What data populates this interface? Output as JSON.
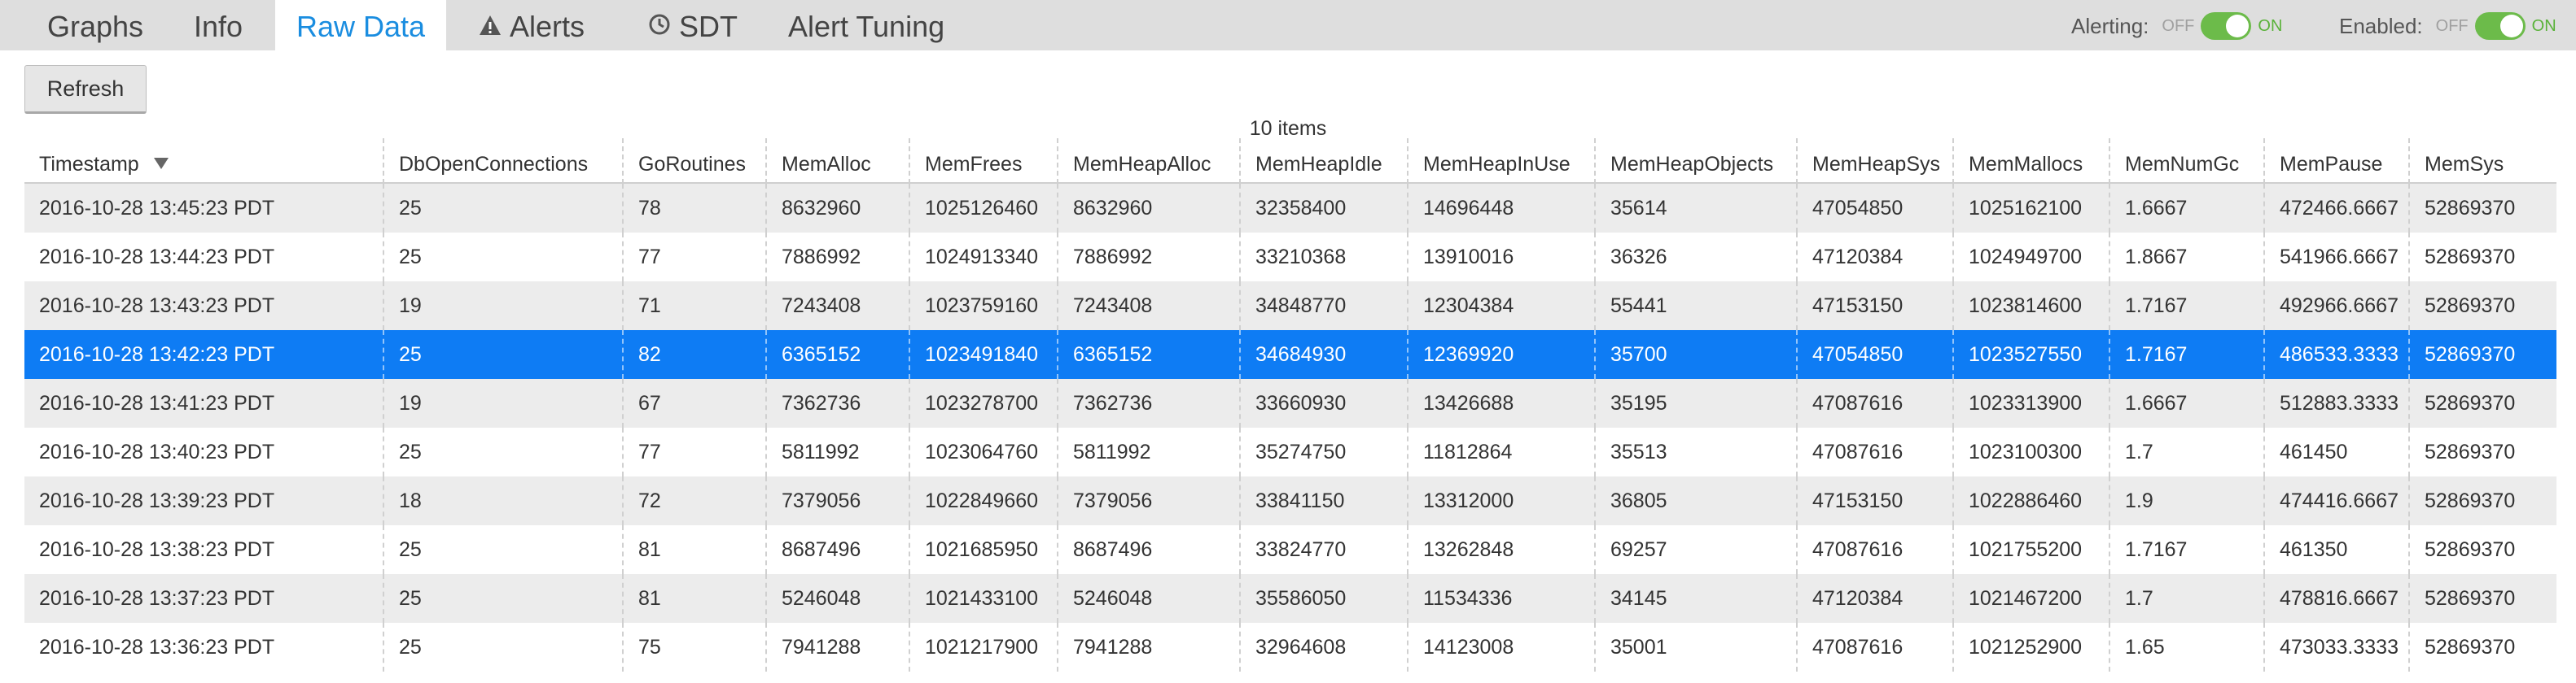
{
  "tabs": [
    {
      "label": "Graphs",
      "icon": null
    },
    {
      "label": "Info",
      "icon": null
    },
    {
      "label": "Raw Data",
      "icon": null
    },
    {
      "label": "Alerts",
      "icon": "warning-icon"
    },
    {
      "label": "SDT",
      "icon": "clock-icon"
    },
    {
      "label": "Alert Tuning",
      "icon": null
    }
  ],
  "active_tab": "Raw Data",
  "alerting": {
    "label": "Alerting:",
    "off_label": "OFF",
    "on_label": "ON",
    "state": "on"
  },
  "enabled": {
    "label": "Enabled:",
    "off_label": "OFF",
    "on_label": "ON",
    "state": "on"
  },
  "toolbar": {
    "refresh_label": "Refresh"
  },
  "table": {
    "item_count": "10 items",
    "sort_column": "Timestamp",
    "sort_direction": "descending",
    "columns": [
      "Timestamp",
      "DbOpenConnections",
      "GoRoutines",
      "MemAlloc",
      "MemFrees",
      "MemHeapAlloc",
      "MemHeapIdle",
      "MemHeapInUse",
      "MemHeapObjects",
      "MemHeapSys",
      "MemMallocs",
      "MemNumGc",
      "MemPause",
      "MemSys"
    ],
    "selected_row": 3,
    "rows": [
      [
        "2016-10-28 13:45:23 PDT",
        "25",
        "78",
        "8632960",
        "1025126460",
        "8632960",
        "32358400",
        "14696448",
        "35614",
        "47054850",
        "1025162100",
        "1.6667",
        "472466.6667",
        "52869370"
      ],
      [
        "2016-10-28 13:44:23 PDT",
        "25",
        "77",
        "7886992",
        "1024913340",
        "7886992",
        "33210368",
        "13910016",
        "36326",
        "47120384",
        "1024949700",
        "1.8667",
        "541966.6667",
        "52869370"
      ],
      [
        "2016-10-28 13:43:23 PDT",
        "19",
        "71",
        "7243408",
        "1023759160",
        "7243408",
        "34848770",
        "12304384",
        "55441",
        "47153150",
        "1023814600",
        "1.7167",
        "492966.6667",
        "52869370"
      ],
      [
        "2016-10-28 13:42:23 PDT",
        "25",
        "82",
        "6365152",
        "1023491840",
        "6365152",
        "34684930",
        "12369920",
        "35700",
        "47054850",
        "1023527550",
        "1.7167",
        "486533.3333",
        "52869370"
      ],
      [
        "2016-10-28 13:41:23 PDT",
        "19",
        "67",
        "7362736",
        "1023278700",
        "7362736",
        "33660930",
        "13426688",
        "35195",
        "47087616",
        "1023313900",
        "1.6667",
        "512883.3333",
        "52869370"
      ],
      [
        "2016-10-28 13:40:23 PDT",
        "25",
        "77",
        "5811992",
        "1023064760",
        "5811992",
        "35274750",
        "11812864",
        "35513",
        "47087616",
        "1023100300",
        "1.7",
        "461450",
        "52869370"
      ],
      [
        "2016-10-28 13:39:23 PDT",
        "18",
        "72",
        "7379056",
        "1022849660",
        "7379056",
        "33841150",
        "13312000",
        "36805",
        "47153150",
        "1022886460",
        "1.9",
        "474416.6667",
        "52869370"
      ],
      [
        "2016-10-28 13:38:23 PDT",
        "25",
        "81",
        "8687496",
        "1021685950",
        "8687496",
        "33824770",
        "13262848",
        "69257",
        "47087616",
        "1021755200",
        "1.7167",
        "461350",
        "52869370"
      ],
      [
        "2016-10-28 13:37:23 PDT",
        "25",
        "81",
        "5246048",
        "1021433100",
        "5246048",
        "35586050",
        "11534336",
        "34145",
        "47120384",
        "1021467200",
        "1.7",
        "478816.6667",
        "52869370"
      ],
      [
        "2016-10-28 13:36:23 PDT",
        "25",
        "75",
        "7941288",
        "1021217900",
        "7941288",
        "32964608",
        "14123008",
        "35001",
        "47087616",
        "1021252900",
        "1.65",
        "473033.3333",
        "52869370"
      ]
    ]
  }
}
